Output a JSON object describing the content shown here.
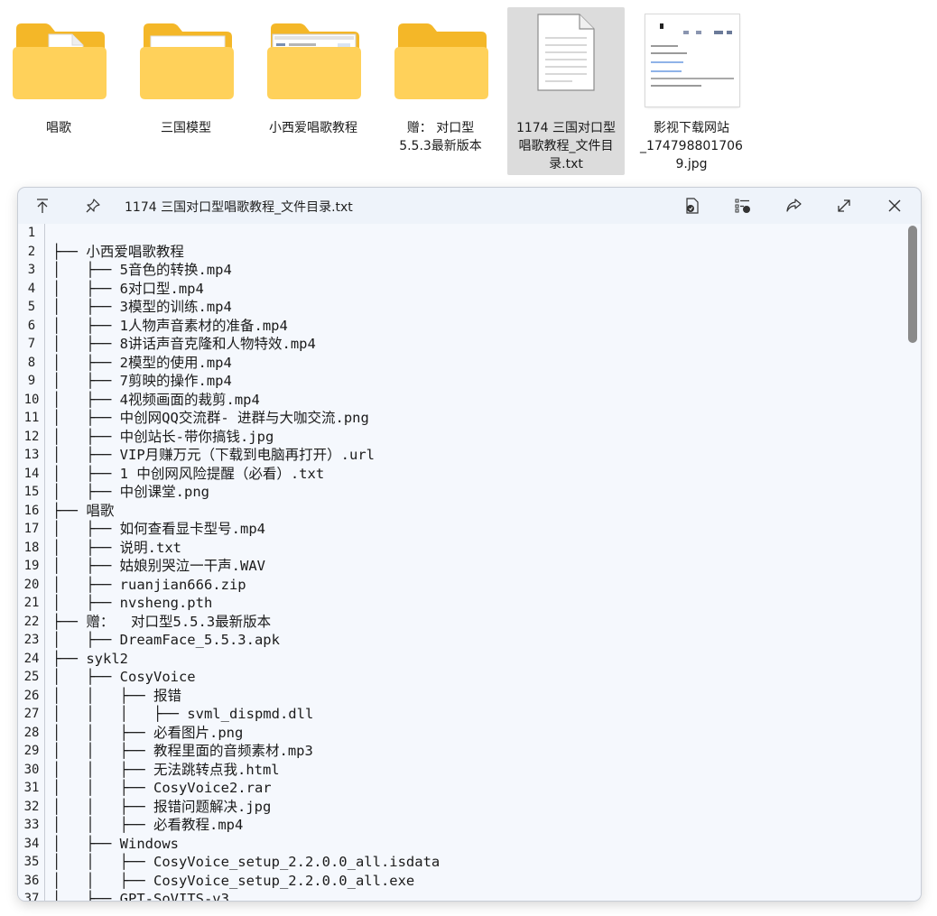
{
  "files": [
    {
      "name": "唱歌",
      "kind": "folder"
    },
    {
      "name": "三国模型",
      "kind": "folder"
    },
    {
      "name": "小西爱唱歌教程",
      "kind": "folder"
    },
    {
      "name": "赠：  对口型\n5.5.3最新版本",
      "kind": "folder"
    },
    {
      "name": "1174 三国对口型\n唱歌教程_文件目\n录.txt",
      "kind": "text-file",
      "selected": true
    },
    {
      "name": "影视下载网站\n_174798801706\n9.jpg",
      "kind": "image-file"
    }
  ],
  "preview": {
    "title": "1174 三国对口型唱歌教程_文件目录.txt",
    "icons": {
      "go_up": "arrow-up-to-line-icon",
      "pin": "pin-icon",
      "open_with": "open-file-icon",
      "details": "details-list-icon",
      "share": "share-icon",
      "expand": "expand-icon",
      "close": "close-icon"
    },
    "lines": [
      {
        "n": "1",
        "t": ""
      },
      {
        "n": "2",
        "t": "├── 小西爱唱歌教程"
      },
      {
        "n": "3",
        "t": "│   ├── 5音色的转换.mp4"
      },
      {
        "n": "4",
        "t": "│   ├── 6对口型.mp4"
      },
      {
        "n": "5",
        "t": "│   ├── 3模型的训练.mp4"
      },
      {
        "n": "6",
        "t": "│   ├── 1人物声音素材的准备.mp4"
      },
      {
        "n": "7",
        "t": "│   ├── 8讲话声音克隆和人物特效.mp4"
      },
      {
        "n": "8",
        "t": "│   ├── 2模型的使用.mp4"
      },
      {
        "n": "9",
        "t": "│   ├── 7剪映的操作.mp4"
      },
      {
        "n": "10",
        "t": "│   ├── 4视频画面的裁剪.mp4"
      },
      {
        "n": "11",
        "t": "│   ├── 中创网QQ交流群- 进群与大咖交流.png"
      },
      {
        "n": "12",
        "t": "│   ├── 中创站长-带你搞钱.jpg"
      },
      {
        "n": "13",
        "t": "│   ├── VIP月赚万元（下载到电脑再打开）.url"
      },
      {
        "n": "14",
        "t": "│   ├── 1 中创网风险提醒（必看）.txt"
      },
      {
        "n": "15",
        "t": "│   ├── 中创课堂.png"
      },
      {
        "n": "16",
        "t": "├── 唱歌"
      },
      {
        "n": "17",
        "t": "│   ├── 如何查看显卡型号.mp4"
      },
      {
        "n": "18",
        "t": "│   ├── 说明.txt"
      },
      {
        "n": "19",
        "t": "│   ├── 姑娘别哭泣一干声.WAV"
      },
      {
        "n": "20",
        "t": "│   ├── ruanjian666.zip"
      },
      {
        "n": "21",
        "t": "│   ├── nvsheng.pth"
      },
      {
        "n": "22",
        "t": "├── 赠：  对口型5.5.3最新版本"
      },
      {
        "n": "23",
        "t": "│   ├── DreamFace_5.5.3.apk"
      },
      {
        "n": "24",
        "t": "├── sykl2"
      },
      {
        "n": "25",
        "t": "│   ├── CosyVoice"
      },
      {
        "n": "26",
        "t": "│   │   ├── 报错"
      },
      {
        "n": "27",
        "t": "│   │   │   ├── svml_dispmd.dll"
      },
      {
        "n": "28",
        "t": "│   │   ├── 必看图片.png"
      },
      {
        "n": "29",
        "t": "│   │   ├── 教程里面的音频素材.mp3"
      },
      {
        "n": "30",
        "t": "│   │   ├── 无法跳转点我.html"
      },
      {
        "n": "31",
        "t": "│   │   ├── CosyVoice2.rar"
      },
      {
        "n": "32",
        "t": "│   │   ├── 报错问题解决.jpg"
      },
      {
        "n": "33",
        "t": "│   │   ├── 必看教程.mp4"
      },
      {
        "n": "34",
        "t": "│   ├── Windows"
      },
      {
        "n": "35",
        "t": "│   │   ├── CosyVoice_setup_2.2.0.0_all.isdata"
      },
      {
        "n": "36",
        "t": "│   │   ├── CosyVoice_setup_2.2.0.0_all.exe"
      },
      {
        "n": "37",
        "t": "│   ├── GPT-SoVITS-v3"
      }
    ]
  },
  "colors": {
    "folder_back": "#f4b728",
    "folder_front": "#ffd15a",
    "selected_bg": "#dcdcdc",
    "window_bg": "#f5f8fd",
    "scrollbar": "#8a8a8a"
  }
}
